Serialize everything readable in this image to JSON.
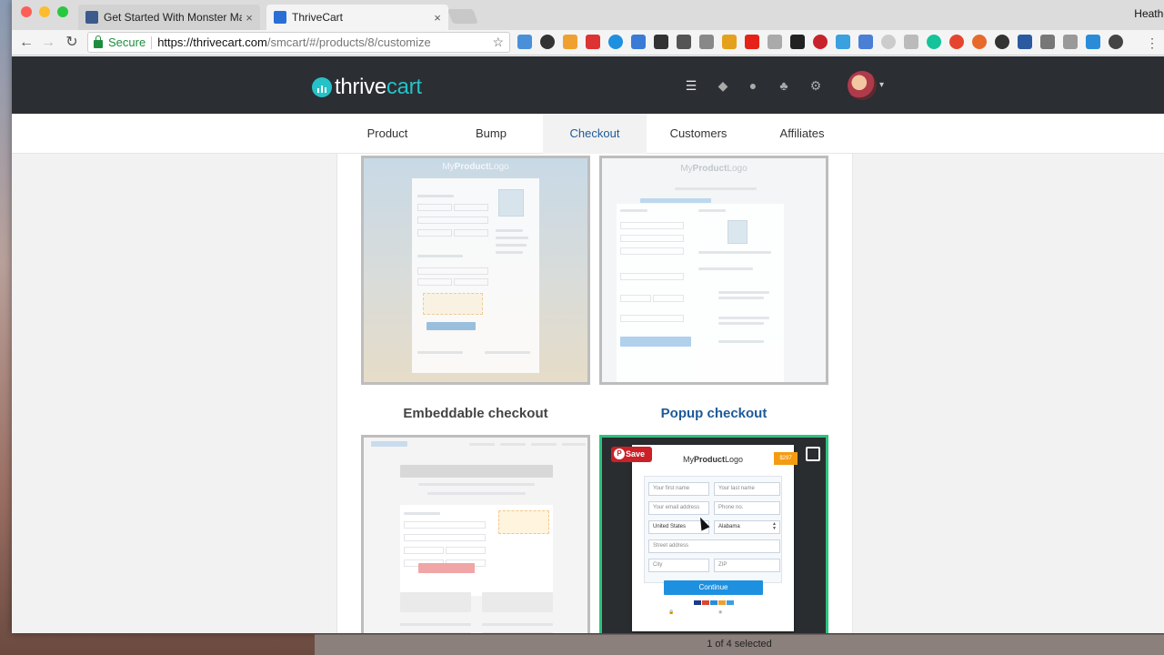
{
  "browser": {
    "tabs": [
      {
        "label": "Get Started With Monster Mar|",
        "close": "×"
      },
      {
        "label": "ThriveCart",
        "close": "×"
      }
    ],
    "profile_name": "Heathe",
    "address": {
      "secure_label": "Secure",
      "host": "https://thrivecart.com",
      "path": "/smcart/#/products/8/customize"
    }
  },
  "header": {
    "logo_prefix": "thrive",
    "logo_suffix": "cart"
  },
  "nav": {
    "tabs": [
      {
        "label": "Product",
        "active": false
      },
      {
        "label": "Bump",
        "active": false
      },
      {
        "label": "Checkout",
        "active": true
      },
      {
        "label": "Customers",
        "active": false
      },
      {
        "label": "Affiliates",
        "active": false
      }
    ]
  },
  "templates": {
    "logo_my": "My",
    "logo_product": "Product",
    "logo_logo": "Logo",
    "embeddable_caption": "Embeddable checkout",
    "popup_caption": "Popup checkout",
    "save_label": "Save",
    "popup": {
      "price": "$297",
      "first_name": "Your first name",
      "last_name": "Your last name",
      "email": "Your email address",
      "phone": "Phone no.",
      "country": "United States",
      "state": "Alabama",
      "street": "Street address",
      "city": "City",
      "zip": "ZIP",
      "continue": "Continue"
    }
  },
  "status": {
    "text": "1 of 4 selected"
  },
  "colors": {
    "accent": "#25c2c7",
    "active_tab": "#1e5a9a",
    "header_bg": "#2b2e33",
    "selected_border": "#2ec27e",
    "continue_button": "#1e90e0"
  }
}
